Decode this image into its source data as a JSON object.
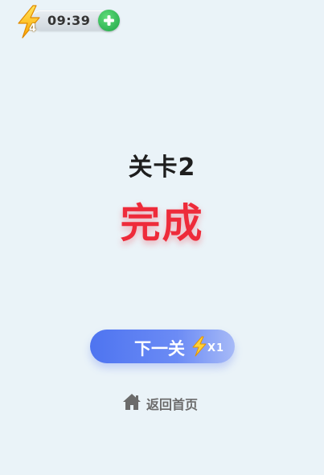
{
  "status_bar": {
    "energy_count": "4",
    "timer": "09:39"
  },
  "result": {
    "level_title": "关卡2",
    "complete_text": "完成"
  },
  "next_button": {
    "label": "下一关",
    "cost": "X1"
  },
  "home_link": {
    "label": "返回首页"
  },
  "colors": {
    "background": "#eaf3f8",
    "complete_red": "#ee2b3a",
    "button_blue": "#4e74f0",
    "add_green": "#1fa446",
    "bolt_yellow": "#ffc21a"
  },
  "icons": {
    "energy": "lightning-bolt-icon",
    "add": "plus-icon",
    "home": "home-icon"
  }
}
